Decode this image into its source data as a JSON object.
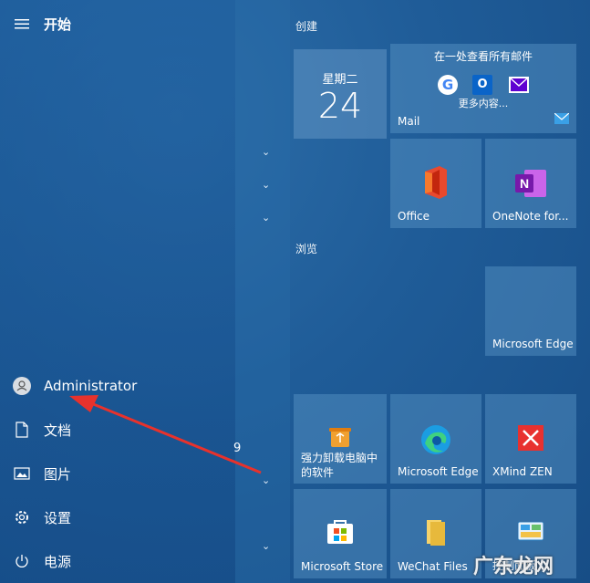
{
  "start": {
    "title": "开始"
  },
  "nav": {
    "user": "Administrator",
    "documents": "文档",
    "pictures": "图片",
    "settings": "设置",
    "power": "电源"
  },
  "app_list": {
    "jump_letter": "9"
  },
  "groups": {
    "create": "创建",
    "browse": "浏览"
  },
  "tiles": {
    "calendar": {
      "weekday": "星期二",
      "day": "24"
    },
    "mail": {
      "headline": "在一处查看所有邮件",
      "more": "更多内容...",
      "label": "Mail"
    },
    "office": {
      "label": "Office"
    },
    "onenote": {
      "label": "OneNote for..."
    },
    "edge_big": {
      "label": "Microsoft Edge"
    },
    "uninstaller": {
      "label_line1": "强力卸载电脑中",
      "label_line2": "的软件"
    },
    "edge_small": {
      "label": "Microsoft Edge"
    },
    "xmind": {
      "label": "XMind ZEN"
    },
    "store": {
      "label": "Microsoft Store"
    },
    "wechat": {
      "label": "WeChat Files"
    },
    "control": {
      "label": "控制面板"
    }
  },
  "watermark": {
    "text": "广东龙网"
  },
  "colors": {
    "arrow": "#e8322c",
    "tile": "#5a96c8"
  }
}
